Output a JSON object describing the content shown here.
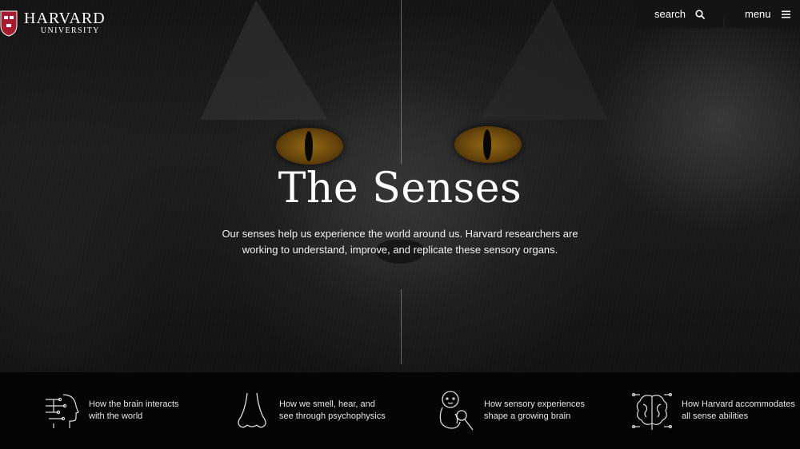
{
  "logo": {
    "name": "HARVARD",
    "sub": "UNIVERSITY",
    "shield_color": "#a51c30"
  },
  "nav": {
    "search_label": "search",
    "menu_label": "menu"
  },
  "hero": {
    "title": "The Senses",
    "description": "Our senses help us experience the world around us. Harvard researchers are working to understand, improve, and replicate these sensory organs."
  },
  "topics": [
    {
      "line1": "How the brain interacts",
      "line2": "with the world",
      "icon": "brain-head-circuit-icon"
    },
    {
      "line1": "How we smell, hear, and",
      "line2": "see through psychophysics",
      "icon": "nose-icon"
    },
    {
      "line1": "How sensory experiences",
      "line2": "shape a growing brain",
      "icon": "baby-rattle-icon"
    },
    {
      "line1": "How Harvard accommodates",
      "line2": "all sense abilities",
      "icon": "brain-network-icon"
    }
  ]
}
